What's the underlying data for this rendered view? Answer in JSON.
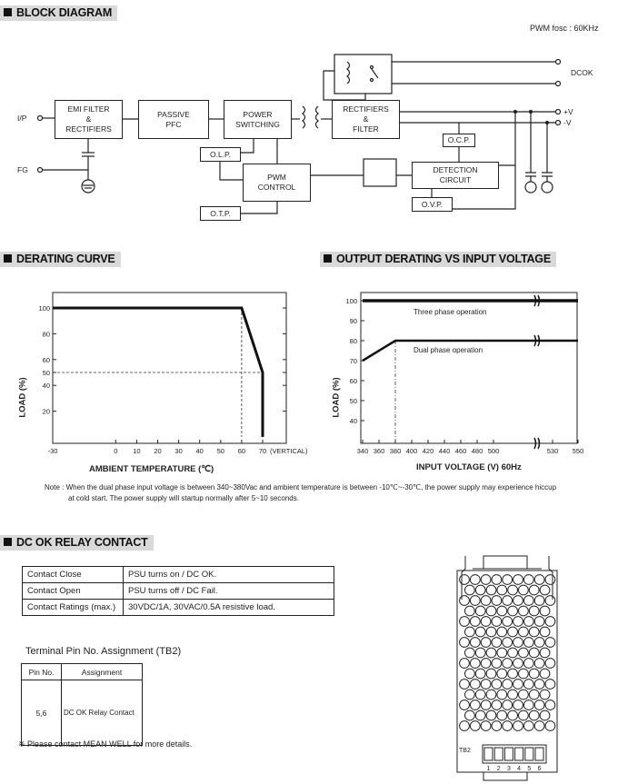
{
  "sections": {
    "block_diagram": "BLOCK DIAGRAM",
    "derating_curve": "DERATING CURVE",
    "output_derating": "OUTPUT DERATING VS INPUT VOLTAGE",
    "dc_ok": "DC OK RELAY CONTACT"
  },
  "block": {
    "pwm_fosc": "PWM fosc : 60KHz",
    "ip": "I/P",
    "fg": "FG",
    "emi": "EMI FILTER\n&\nRECTIFIERS",
    "pfc": "PASSIVE\nPFC",
    "switching": "POWER\nSWITCHING",
    "rectifiers": "RECTIFIERS\n&\nFILTER",
    "olp": "O.L.P.",
    "otp": "O.T.P.",
    "pwm": "PWM\nCONTROL",
    "ocp": "O.C.P.",
    "detection": "DETECTION\nCIRCUIT",
    "ovp": "O.V.P.",
    "dcok": "DCOK",
    "pos_v": "+V",
    "neg_v": "-V"
  },
  "chart_data": [
    {
      "type": "line",
      "xlabel": "AMBIENT TEMPERATURE (℃)",
      "ylabel": "LOAD (%)",
      "x_ticks": [
        -30,
        0,
        10,
        20,
        30,
        40,
        50,
        60,
        70
      ],
      "x_tick_suffix": "(VERTICAL)",
      "y_ticks": [
        20,
        40,
        50,
        60,
        80,
        100
      ],
      "xlim": [
        -30,
        80
      ],
      "ylim": [
        0,
        105
      ],
      "grid": false,
      "series": [
        {
          "points": [
            [
              -30,
              100
            ],
            [
              60,
              100
            ],
            [
              70,
              50
            ],
            [
              70,
              0
            ]
          ]
        }
      ],
      "guides": [
        [
          [
            60,
            100
          ],
          [
            60,
            0
          ]
        ],
        [
          [
            -30,
            50
          ],
          [
            70,
            50
          ]
        ]
      ]
    },
    {
      "type": "line",
      "xlabel": "INPUT VOLTAGE (V) 60Hz",
      "ylabel": "LOAD (%)",
      "x_ticks": [
        340,
        360,
        380,
        400,
        420,
        440,
        460,
        480,
        500,
        530,
        550
      ],
      "y_ticks": [
        40,
        50,
        60,
        70,
        80,
        90,
        100
      ],
      "xlim": [
        340,
        550
      ],
      "ylim": [
        30,
        105
      ],
      "axis_break": "between 500 and 530",
      "grid": false,
      "series": [
        {
          "name": "Three phase operation",
          "points": [
            [
              340,
              100
            ],
            [
              550,
              100
            ]
          ]
        },
        {
          "name": "Dual phase operation",
          "points": [
            [
              340,
              70
            ],
            [
              380,
              80
            ],
            [
              550,
              80
            ]
          ]
        }
      ],
      "guides": [
        [
          [
            380,
            80
          ],
          [
            380,
            30
          ]
        ]
      ]
    }
  ],
  "note": {
    "line1": "Note : When the dual phase input voltage is between 340~380Vac and ambient temperature is between -10℃~-30℃, the power supply may experience hiccup",
    "line2": "at cold start. The power supply will startup normally after 5~10 seconds."
  },
  "relay_table": [
    {
      "condition": "Contact Close",
      "description": "PSU turns on / DC OK."
    },
    {
      "condition": "Contact Open",
      "description": "PSU turns off / DC Fail."
    },
    {
      "condition": "Contact Ratings (max.)",
      "description": "30VDC/1A, 30VAC/0.5A resistive load."
    }
  ],
  "terminal": {
    "title": "Terminal Pin No.  Assignment (TB2)",
    "headers": [
      "Pin No.",
      "Assignment"
    ],
    "rows": [
      {
        "pin": "5,6",
        "assignment": "DC OK Relay Contact"
      }
    ]
  },
  "footnote": "※ Please contact MEAN WELL for more details.",
  "psu": {
    "tb_label": "TB2",
    "pins": [
      "1",
      "2",
      "3",
      "4",
      "5",
      "6"
    ]
  }
}
